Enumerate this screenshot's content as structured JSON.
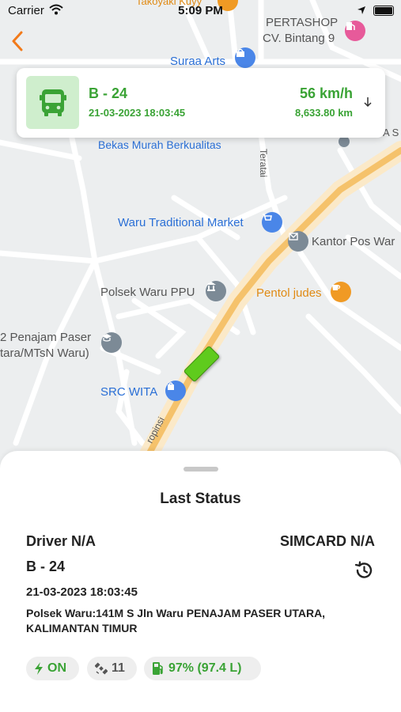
{
  "status_bar": {
    "carrier": "Carrier",
    "time": "5:09 PM"
  },
  "vehicle_card": {
    "plate": "B - 24",
    "datetime": "21-03-2023 18:03:45",
    "speed": "56 km/h",
    "odometer": "8,633.80 km"
  },
  "map": {
    "labels": {
      "takoyaki": "Takoyaki Kuyy",
      "pertashop_1": "PERTASHOP",
      "pertashop_2": "CV. Bintang 9",
      "suraa_arts": "Suraa Arts",
      "bekas_murah": "Bekas Murah Berkualitas",
      "teratai": "Teratai",
      "waru_market": "Waru Traditional Market",
      "kantor_pos": "Kantor Pos War",
      "polsek_waru": "Polsek Waru PPU",
      "pentol_judes": "Pentol judes",
      "penajam_1": "2 Penajam Paser",
      "penajam_2": "tara/MTsN Waru)",
      "src_wita": "SRC WITA",
      "provinsi": "ropinsi",
      "edge_right": "A S"
    }
  },
  "sheet": {
    "title": "Last Status",
    "driver": "Driver N/A",
    "simcard": "SIMCARD N/A",
    "plate": "B - 24",
    "datetime": "21-03-2023 18:03:45",
    "address": "Polsek Waru:141M S Jln Waru PENAJAM PASER UTARA, KALIMANTAN TIMUR",
    "chips": {
      "acc": "ON",
      "satellites": "11",
      "fuel": "97% (97.4 L)"
    }
  },
  "colors": {
    "accent_green": "#3aa335",
    "back_orange": "#f27a1a",
    "map_road_yellow": "#f5c26b",
    "poi_blue": "#4a86e8",
    "poi_gray": "#7c8a96",
    "poi_orange": "#f09a24"
  },
  "icons": {
    "back": "chevron-left-icon",
    "vehicle": "bus-icon",
    "expand": "arrow-down-icon",
    "history": "history-icon",
    "acc": "bolt-icon",
    "satellite": "satellite-icon",
    "fuel": "fuel-pump-icon"
  }
}
